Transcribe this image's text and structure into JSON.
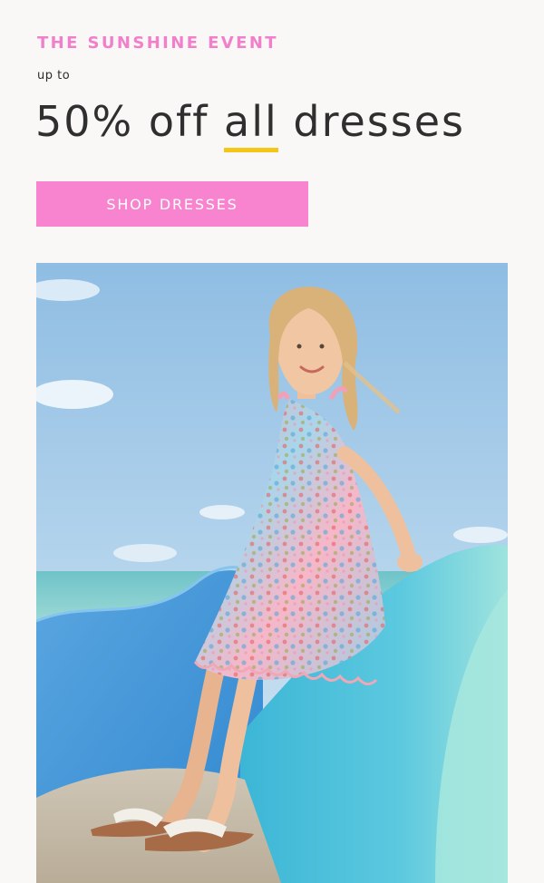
{
  "promo": {
    "eyebrow": "THE SUNSHINE EVENT",
    "upto": "up to",
    "headline_pre": "50% off ",
    "headline_highlight": "all",
    "headline_post": " dresses",
    "cta_label": "SHOP DRESSES"
  },
  "colors": {
    "accent_pink": "#f884cf",
    "eyebrow_pink": "#f27fcb",
    "underline_yellow": "#f5c518",
    "text_dark": "#2f2f2f"
  },
  "hero": {
    "alt": "Girl in floral dress sitting on blue wave sculpture by the beach"
  }
}
